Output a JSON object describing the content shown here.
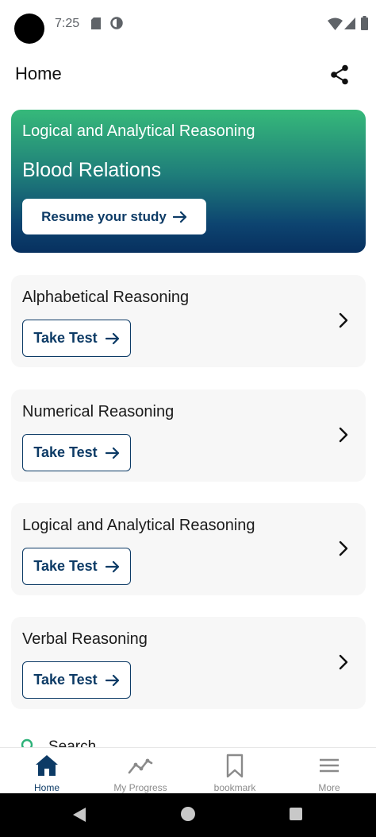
{
  "status_bar": {
    "time": "7:25",
    "icons": [
      "sim-card-icon",
      "data-saver-icon",
      "wifi-icon",
      "cell-signal-icon",
      "battery-icon"
    ]
  },
  "header": {
    "title": "Home",
    "share_icon": "share-icon"
  },
  "hero": {
    "subject": "Logical and Analytical Reasoning",
    "topic": "Blood Relations",
    "resume_label": "Resume your study",
    "gradient_top": "#36b97a",
    "gradient_bottom": "#07305f"
  },
  "categories": [
    {
      "title": "Alphabetical Reasoning",
      "button_label": "Take Test"
    },
    {
      "title": "Numerical Reasoning",
      "button_label": "Take Test"
    },
    {
      "title": "Logical and Analytical Reasoning",
      "button_label": "Take Test"
    },
    {
      "title": "Verbal Reasoning",
      "button_label": "Take Test"
    }
  ],
  "search": {
    "label": "Search"
  },
  "bottom_nav": {
    "items": [
      {
        "label": "Home",
        "icon": "home-icon",
        "active": true
      },
      {
        "label": "My Progress",
        "icon": "progress-chart-icon",
        "active": false
      },
      {
        "label": "bookmark",
        "icon": "bookmark-icon",
        "active": false
      },
      {
        "label": "More",
        "icon": "menu-icon",
        "active": false
      }
    ]
  },
  "colors": {
    "brand": "#0d3b66",
    "card_background": "#f7f7f7",
    "inactive_nav": "#8a8a8a",
    "search_accent": "#2fb27a"
  }
}
